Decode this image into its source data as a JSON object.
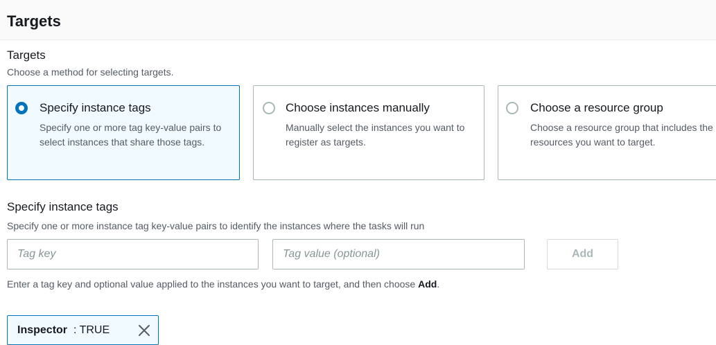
{
  "header": {
    "title": "Targets"
  },
  "targets": {
    "label": "Targets",
    "description": "Choose a method for selecting targets.",
    "options": [
      {
        "title": "Specify instance tags",
        "description": "Specify one or more tag key-value pairs to select instances that share those tags.",
        "selected": true
      },
      {
        "title": "Choose instances manually",
        "description": "Manually select the instances you want to register as targets.",
        "selected": false
      },
      {
        "title": "Choose a resource group",
        "description": "Choose a resource group that includes the resources you want to target.",
        "selected": false
      }
    ]
  },
  "tags": {
    "label": "Specify instance tags",
    "description": "Specify one or more instance tag key-value pairs to identify the instances where the tasks will run",
    "key_placeholder": "Tag key",
    "value_placeholder": "Tag value (optional)",
    "add_label": "Add",
    "hint_prefix": "Enter a tag key and optional value applied to the instances you want to target, and then choose ",
    "hint_bold": "Add",
    "hint_suffix": ".",
    "token": {
      "key": "Inspector",
      "separator_value": ": TRUE"
    }
  },
  "colors": {
    "accent": "#0073bb",
    "selected_bg": "#f1faff",
    "border": "#aab7b8"
  },
  "icons": {
    "remove": "close-icon",
    "radio_selected": "radio-checked-icon",
    "radio_unselected": "radio-unchecked-icon"
  }
}
